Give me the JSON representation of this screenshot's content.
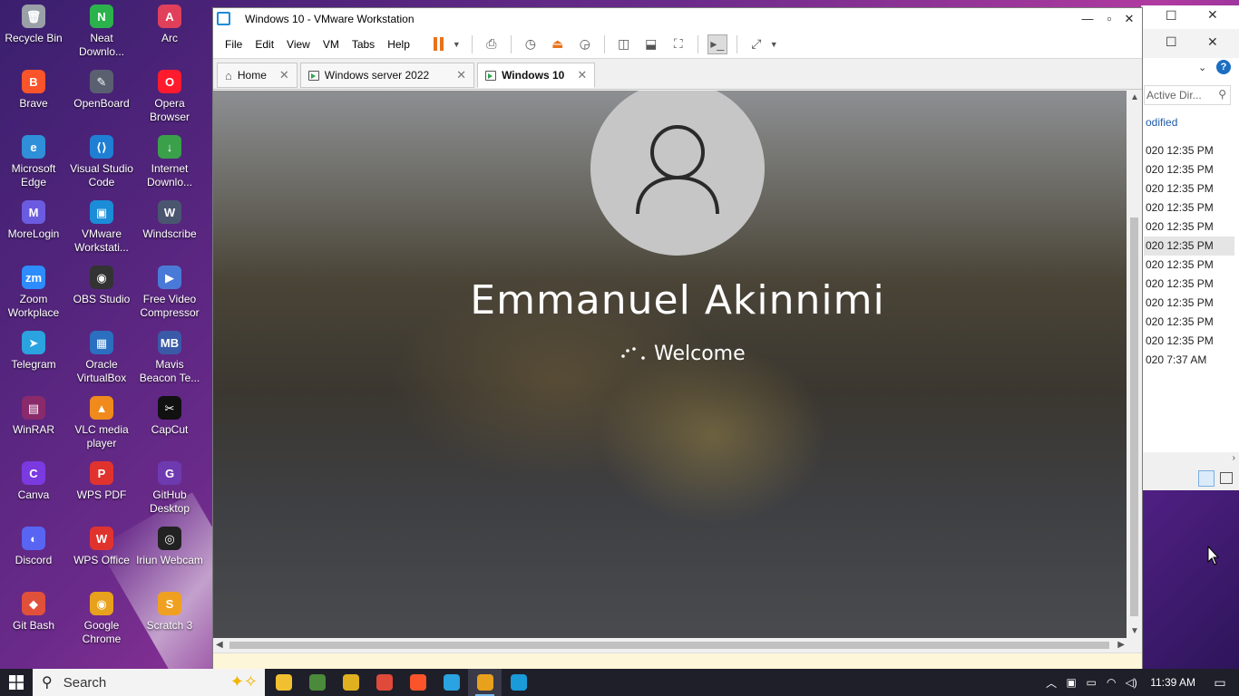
{
  "desktop": {
    "icons": [
      {
        "label": "Recycle Bin",
        "glyph": "🗑",
        "color": "#9aa0a8"
      },
      {
        "label": "Neat Downlo...",
        "glyph": "N",
        "color": "#2bb24c"
      },
      {
        "label": "Arc",
        "glyph": "A",
        "color": "#e0405a"
      },
      {
        "label": "Brave",
        "glyph": "B",
        "color": "#fb542b"
      },
      {
        "label": "OpenBoard",
        "glyph": "✎",
        "color": "#5a6070"
      },
      {
        "label": "Opera Browser",
        "glyph": "O",
        "color": "#ff1b2d"
      },
      {
        "label": "Microsoft Edge",
        "glyph": "e",
        "color": "#2f8fd8"
      },
      {
        "label": "Visual Studio Code",
        "glyph": "⟨⟩",
        "color": "#1f7fd4"
      },
      {
        "label": "Internet Downlo...",
        "glyph": "↓",
        "color": "#3aa04a"
      },
      {
        "label": "MoreLogin",
        "glyph": "M",
        "color": "#6b5be0"
      },
      {
        "label": "VMware Workstati...",
        "glyph": "▣",
        "color": "#1b8cd8"
      },
      {
        "label": "Windscribe",
        "glyph": "W",
        "color": "#4a5670"
      },
      {
        "label": "Zoom Workplace",
        "glyph": "zm",
        "color": "#2d8cff"
      },
      {
        "label": "OBS Studio",
        "glyph": "◉",
        "color": "#333"
      },
      {
        "label": "Free Video Compressor",
        "glyph": "▶",
        "color": "#4a7ad8"
      },
      {
        "label": "Telegram",
        "glyph": "➤",
        "color": "#2aa3e0"
      },
      {
        "label": "Oracle VirtualBox",
        "glyph": "▦",
        "color": "#2a6fc0"
      },
      {
        "label": "Mavis Beacon Te...",
        "glyph": "MB",
        "color": "#3a5aa8"
      },
      {
        "label": "WinRAR",
        "glyph": "▤",
        "color": "#8a2a6a"
      },
      {
        "label": "VLC media player",
        "glyph": "▲",
        "color": "#f08a1c"
      },
      {
        "label": "CapCut",
        "glyph": "✂",
        "color": "#111"
      },
      {
        "label": "Canva",
        "glyph": "C",
        "color": "#7a3ae0"
      },
      {
        "label": "WPS PDF",
        "glyph": "P",
        "color": "#e0332e"
      },
      {
        "label": "GitHub Desktop",
        "glyph": "G",
        "color": "#6e3ab0"
      },
      {
        "label": "Discord",
        "glyph": "◐",
        "color": "#5865f2"
      },
      {
        "label": "WPS Office",
        "glyph": "W",
        "color": "#e0332e"
      },
      {
        "label": "Iriun Webcam",
        "glyph": "◎",
        "color": "#222"
      },
      {
        "label": "Git Bash",
        "glyph": "◆",
        "color": "#e0503a"
      },
      {
        "label": "Google Chrome",
        "glyph": "◉",
        "color": "#e8a11c"
      },
      {
        "label": "Scratch 3",
        "glyph": "S",
        "color": "#f0a020"
      }
    ]
  },
  "bg_window": {
    "search_placeholder": "Active Dir...",
    "column_header": "odified",
    "dates": [
      "020 12:35 PM",
      "020 12:35 PM",
      "020 12:35 PM",
      "020 12:35 PM",
      "020 12:35 PM",
      "020 12:35 PM",
      "020 12:35 PM",
      "020 12:35 PM",
      "020 12:35 PM",
      "020 12:35 PM",
      "020 12:35 PM",
      "020 7:37 AM"
    ],
    "selected_index": 5
  },
  "vmware": {
    "title": "Windows 10  - VMware Workstation",
    "menu": [
      "File",
      "Edit",
      "View",
      "VM",
      "Tabs",
      "Help"
    ],
    "tabs": [
      {
        "label": "Home",
        "active": false,
        "icon": "home-icon"
      },
      {
        "label": "Windows server 2022",
        "active": false,
        "icon": "vm-icon"
      },
      {
        "label": "Windows 10",
        "active": true,
        "icon": "vm-icon"
      }
    ],
    "accent": "#e8731c"
  },
  "vm_screen": {
    "username": "Emmanuel Akinnimi",
    "status": "Welcome"
  },
  "taskbar": {
    "search_placeholder": "Search",
    "apps": [
      {
        "name": "file-explorer",
        "color": "#f0c030"
      },
      {
        "name": "winrar",
        "color": "#4a8a3a"
      },
      {
        "name": "git-app",
        "color": "#e0b020"
      },
      {
        "name": "chrome",
        "color": "#e04a3a"
      },
      {
        "name": "brave",
        "color": "#fb542b"
      },
      {
        "name": "telegram",
        "color": "#2aa3e0"
      },
      {
        "name": "vmware",
        "color": "#e8a11c"
      },
      {
        "name": "visio",
        "color": "#1a9ad8"
      }
    ],
    "active_app_index": 6,
    "time": "11:39 AM"
  }
}
